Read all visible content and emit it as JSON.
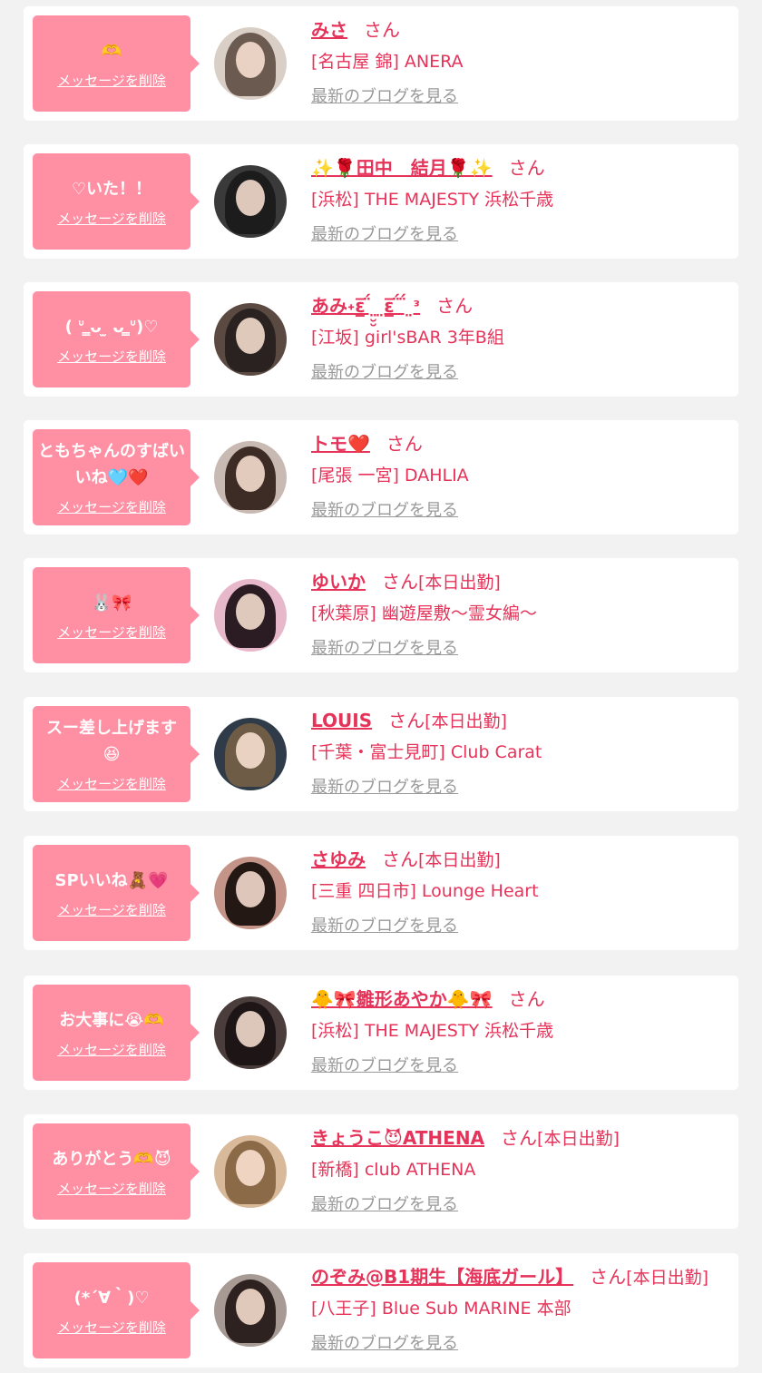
{
  "common": {
    "delete_label": "メッセージを削除",
    "blog_label": "最新のブログを見る",
    "honorific": "さん"
  },
  "colors": {
    "accent": "#e6335a",
    "bubble": "#ff8fa3",
    "background": "#f2f2f2",
    "card": "#ffffff",
    "link_gray": "#999999"
  },
  "items": [
    {
      "message": "🫶",
      "name": "みさ",
      "status": "",
      "shop": "[名古屋 錦] ANERA",
      "avatar_bg": "#d9cfc6",
      "avatar_hair": "#6b5a50"
    },
    {
      "message": "♡いた！！",
      "name": "✨🌹田中　結月🌹✨",
      "status": "",
      "shop": "[浜松] THE MAJESTY 浜松千歳",
      "avatar_bg": "#3a3a3a",
      "avatar_hair": "#1c1c1c"
    },
    {
      "message": "( ᐡ ̳ᴗ ̫ ᴗ ̳ᐡ)♡",
      "name": "あみ˖ɛ̲̅ ̈́ ̤̮̮ ̤ɛ̲̅ ̈́ ̈́ ̤ᵌ",
      "status": "",
      "shop": "[江坂] girl'sBAR 3年B組",
      "avatar_bg": "#5a4a42",
      "avatar_hair": "#2a2220"
    },
    {
      "message": "ともちゃんのすばいいね🩵❤️",
      "name": "トモ❤️",
      "status": "",
      "shop": "[尾張 一宮] DAHLIA",
      "avatar_bg": "#c9b9b3",
      "avatar_hair": "#3d2b26"
    },
    {
      "message": "🐰🎀",
      "name": "ゆいか",
      "status": "[本日出勤]",
      "shop": "[秋葉原] 幽遊屋敷〜霊女編〜",
      "avatar_bg": "#e7b8c9",
      "avatar_hair": "#2b1b22"
    },
    {
      "message": "スー差し上げます😆",
      "name": "LOUIS",
      "status": "[本日出勤]",
      "shop": "[千葉・富士見町] Club Carat",
      "avatar_bg": "#2f3b49",
      "avatar_hair": "#6e5c47"
    },
    {
      "message": "SPいいね🧸💗",
      "name": "さゆみ",
      "status": "[本日出勤]",
      "shop": "[三重 四日市] Lounge Heart",
      "avatar_bg": "#c49488",
      "avatar_hair": "#241815"
    },
    {
      "message": "お大事に😭🫶",
      "name": "🐥🎀雛形あやか🐥🎀",
      "status": "",
      "shop": "[浜松] THE MAJESTY 浜松千歳",
      "avatar_bg": "#4a3d3b",
      "avatar_hair": "#1e1616"
    },
    {
      "message": "ありがとう🫶😈",
      "name": "きょうこ😈ATHENA",
      "status": "[本日出勤]",
      "shop": "[新橋] club ATHENA",
      "avatar_bg": "#d8b99a",
      "avatar_hair": "#8b6a48"
    },
    {
      "message": "(*´∀｀)♡",
      "name": "のぞみ@B1期生【海底ガール】",
      "status": "[本日出勤]",
      "shop": "[八王子] Blue Sub MARINE 本部",
      "avatar_bg": "#a79a95",
      "avatar_hair": "#2e2220"
    }
  ]
}
